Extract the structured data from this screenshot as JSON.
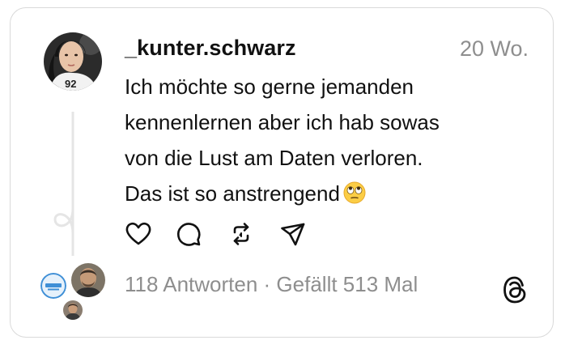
{
  "post": {
    "username": "_kunter.schwarz",
    "timestamp": "20 Wo.",
    "text_lines": [
      "Ich möchte so gerne jemanden",
      "kennenlernen aber ich hab sowas",
      "von die Lust am Daten verloren.",
      "Das ist so anstrengend"
    ],
    "emoji": "face-with-rolling-eyes"
  },
  "actions": {
    "like": "heart-icon",
    "reply": "speech-bubble-icon",
    "repost": "repost-arrows-icon",
    "share": "paper-plane-icon"
  },
  "footer": {
    "replies": "118 Antworten",
    "separator": " · ",
    "likes": "Gefällt 513 Mal"
  },
  "colors": {
    "text": "#111111",
    "muted": "#8e8e8e",
    "border": "#d9d9d9",
    "thread_line": "#e5e5e5"
  }
}
